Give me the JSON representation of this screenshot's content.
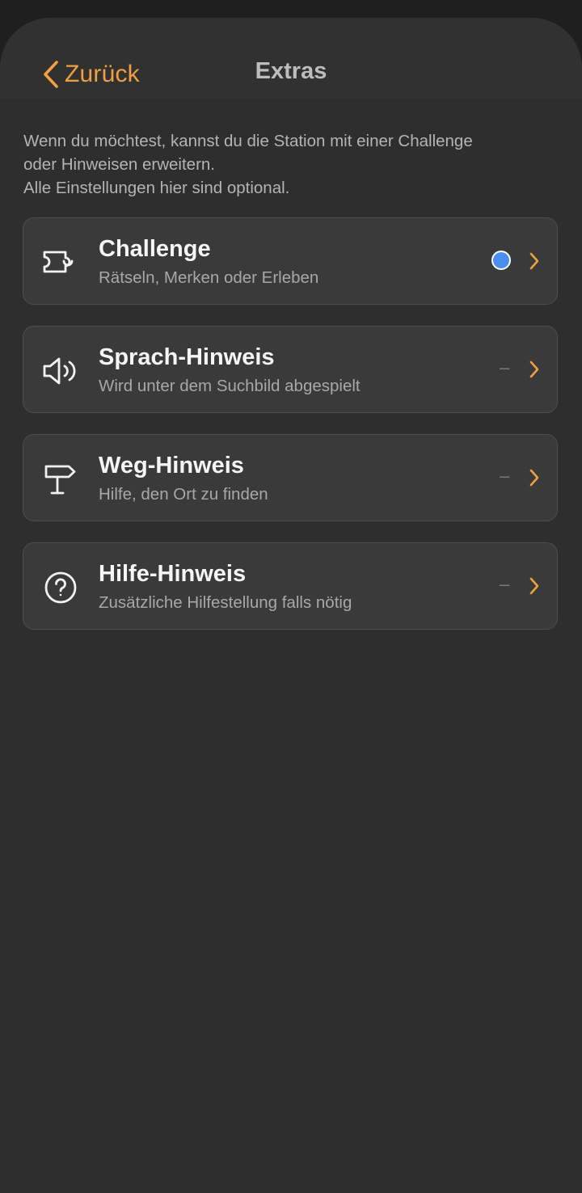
{
  "nav": {
    "back_label": "Zurück",
    "title": "Extras"
  },
  "intro": {
    "line1": "Wenn du möchtest, kannst du die Station mit einer Challenge",
    "line2": "oder Hinweisen erweitern.",
    "line3": "Alle Einstellungen hier sind optional."
  },
  "colors": {
    "accent": "#f0a040",
    "status_dot": "#4a8ef0",
    "background": "#2e2e2e",
    "card": "#3a3a3a"
  },
  "items": [
    {
      "icon": "puzzle-icon",
      "title": "Challenge",
      "subtitle": "Rätseln, Merken oder Erleben",
      "status": "dot"
    },
    {
      "icon": "speaker-icon",
      "title": "Sprach-Hinweis",
      "subtitle": "Wird unter dem Suchbild abgespielt",
      "status": "–"
    },
    {
      "icon": "signpost-icon",
      "title": "Weg-Hinweis",
      "subtitle": "Hilfe, den Ort zu finden",
      "status": "–"
    },
    {
      "icon": "question-circle-icon",
      "title": "Hilfe-Hinweis",
      "subtitle": "Zusätzliche Hilfestellung falls nötig",
      "status": "–"
    }
  ]
}
